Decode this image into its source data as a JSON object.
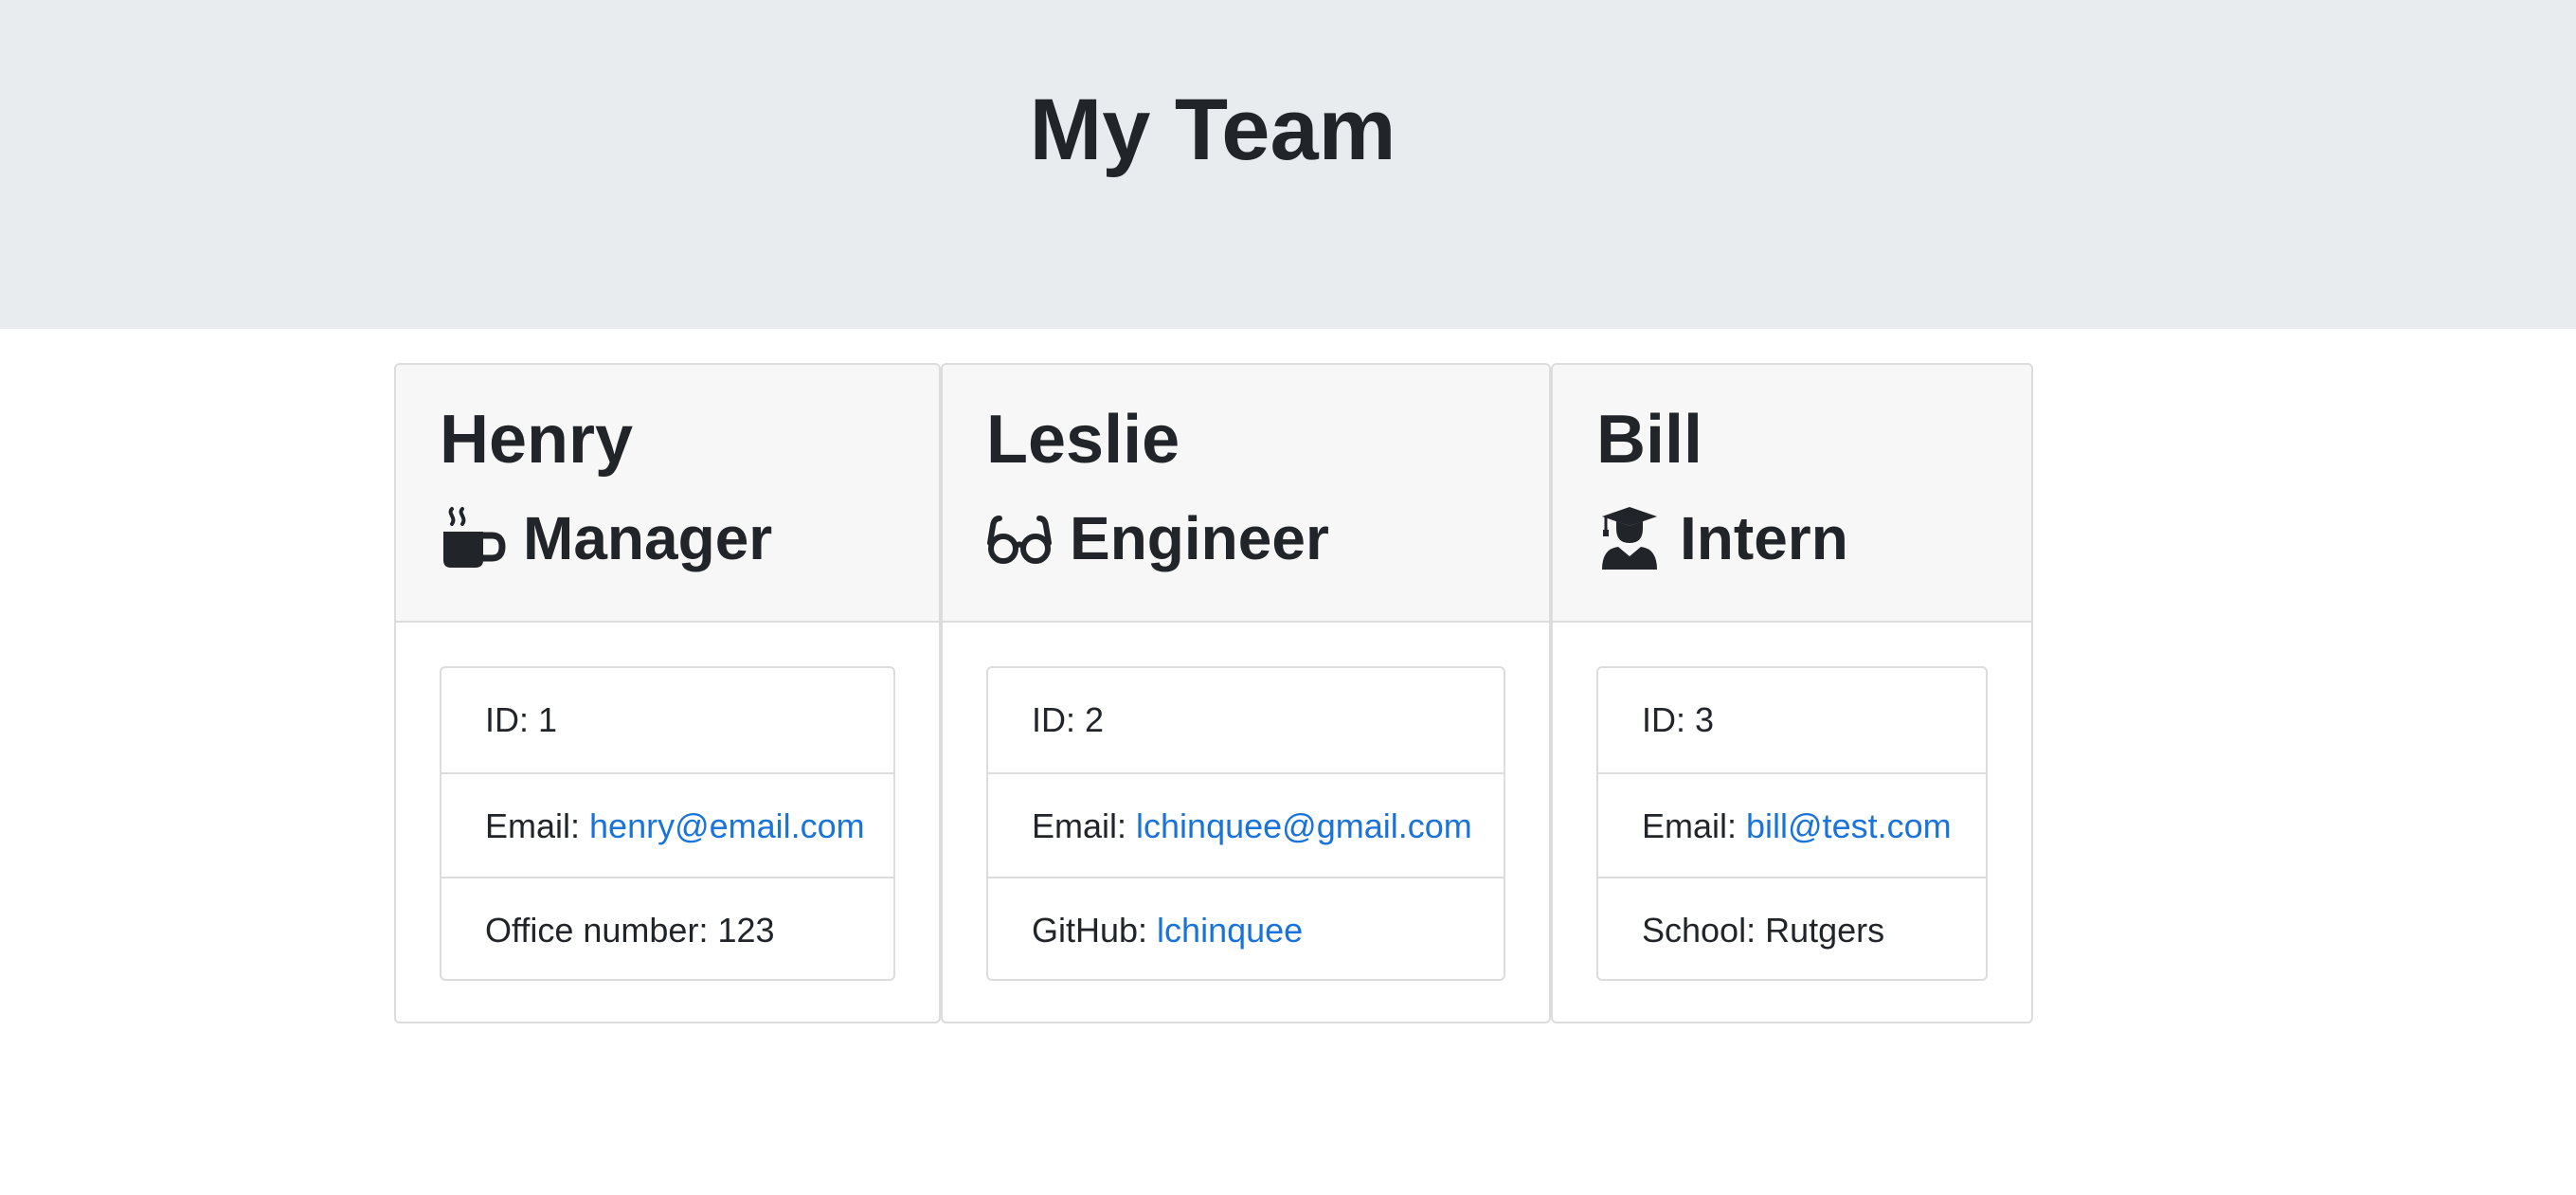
{
  "header": {
    "title": "My Team"
  },
  "team": [
    {
      "name": "Henry",
      "role": "Manager",
      "icon": "mug-hot-icon",
      "id_label": "ID: 1",
      "email_label": "Email: ",
      "email": "henry@email.com",
      "extra_label": "Office number: 123",
      "extra_value": ""
    },
    {
      "name": "Leslie",
      "role": "Engineer",
      "icon": "glasses-icon",
      "id_label": "ID: 2",
      "email_label": "Email: ",
      "email": "lchinquee@gmail.com",
      "extra_label": "GitHub: ",
      "extra_value": "lchinquee"
    },
    {
      "name": "Bill",
      "role": "Intern",
      "icon": "user-graduate-icon",
      "id_label": "ID: 3",
      "email_label": "Email: ",
      "email": "bill@test.com",
      "extra_label": "School: Rutgers",
      "extra_value": ""
    }
  ],
  "colors": {
    "jumbotron_bg": "#e9ecef",
    "card_header_bg": "#f7f7f7",
    "link": "#1a73d9",
    "text": "#212529"
  }
}
